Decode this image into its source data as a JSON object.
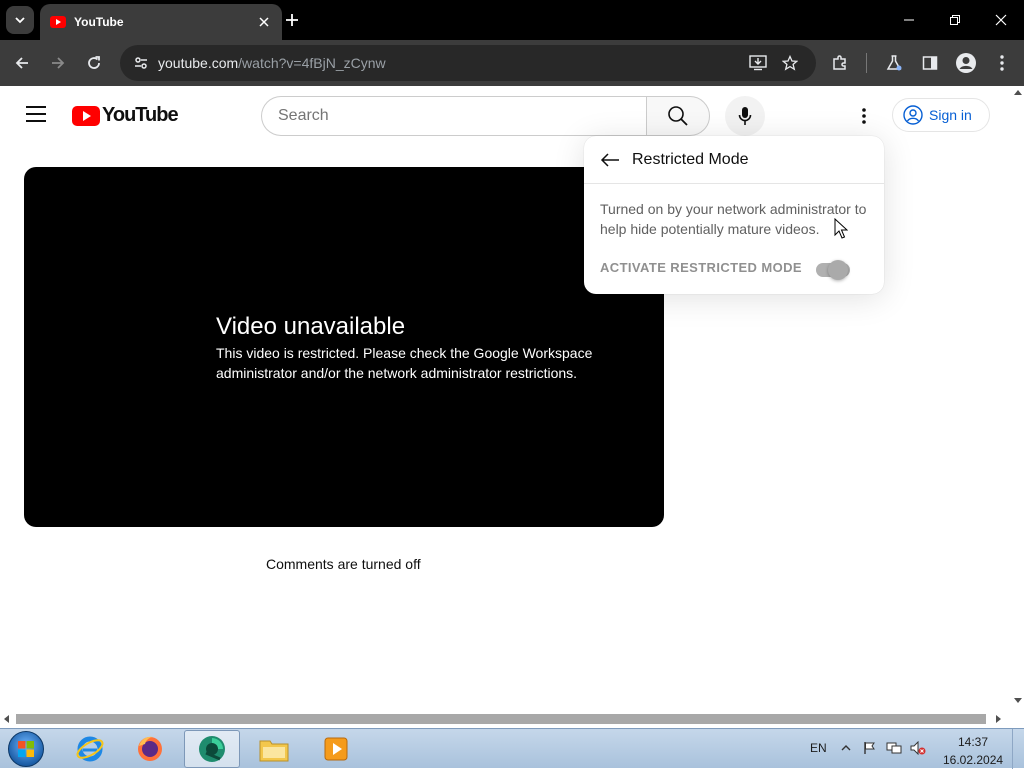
{
  "browser": {
    "tab": {
      "title": "YouTube"
    },
    "url": {
      "domain": "youtube.com",
      "path": "/watch?v=4fBjN_zCynw"
    }
  },
  "youtube": {
    "logo_text": "YouTube",
    "search": {
      "placeholder": "Search",
      "value": ""
    },
    "sign_in_label": "Sign in",
    "player": {
      "title": "Video unavailable",
      "message": "This video is restricted. Please check the Google Workspace administrator and/or the network administrator restrictions."
    },
    "comments_status": "Comments are turned off",
    "restricted_mode_popup": {
      "title": "Restricted Mode",
      "description": "Turned on by your network administrator to help hide potentially mature videos.",
      "toggle_label": "ACTIVATE RESTRICTED MODE",
      "toggle_state": "on (disabled)"
    }
  },
  "taskbar": {
    "language": "EN",
    "time": "14:37",
    "date": "16.02.2024",
    "apps": [
      "internet-explorer",
      "firefox",
      "chrome-like-browser",
      "file-explorer",
      "media-player"
    ]
  },
  "colors": {
    "youtube_red": "#ff0000",
    "link_blue": "#065fd4",
    "browser_dark": "#3c3c3c"
  }
}
